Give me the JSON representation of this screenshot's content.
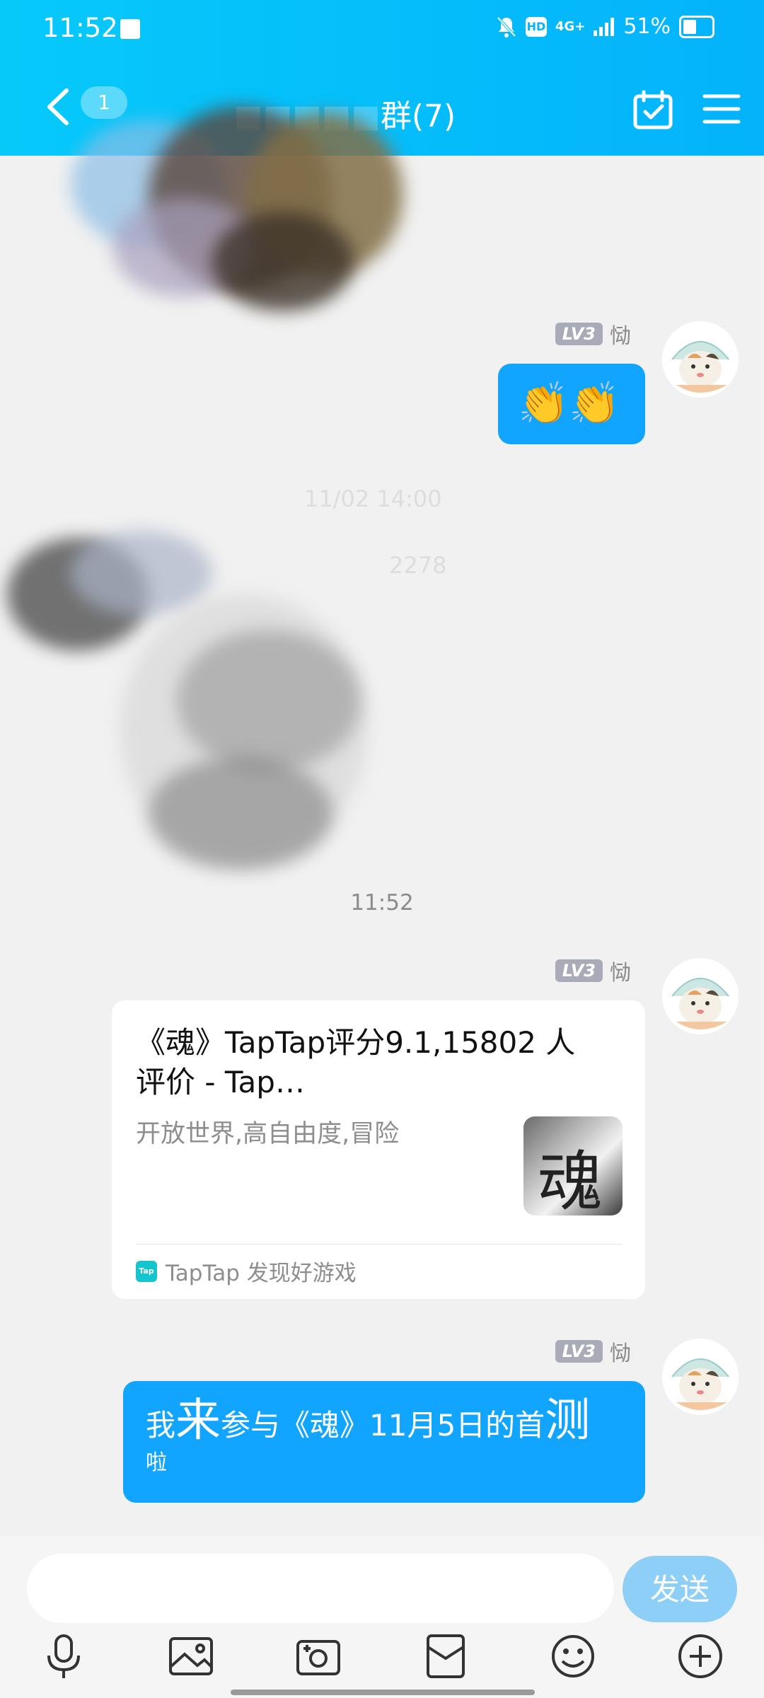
{
  "status_bar": {
    "time": "11:52",
    "network": "4G+",
    "battery": "51%",
    "hd_label": "HD"
  },
  "nav": {
    "unread_count": "1",
    "title_hidden": "■■■■■",
    "title_visible": "群(7)",
    "member_count_label": "(7)"
  },
  "messages": {
    "sender_level": "LV3",
    "sender_name": "恸",
    "clap_emoji": "👏👏",
    "blurred_time": "11/02 14:00",
    "blurred_id": "2278",
    "timestamp": "11:52",
    "share_card": {
      "title": "《魂》TapTap评分9.1,15802 人评价 - Tap…",
      "description": "开放世界,高自由度,冒险",
      "thumb_glyph": "魂",
      "source_logo": "Tap",
      "source": "TapTap 发现好游戏"
    },
    "join_msg": {
      "part1": "我",
      "part2": "来",
      "part3": "参与《魂》11月5日的首",
      "part4": "测",
      "part5": "啦"
    }
  },
  "input": {
    "placeholder": "",
    "send_label": "发送"
  },
  "colors": {
    "header": "#06c9fa",
    "bubble": "#12a5ff",
    "send": "#8ecff7"
  }
}
